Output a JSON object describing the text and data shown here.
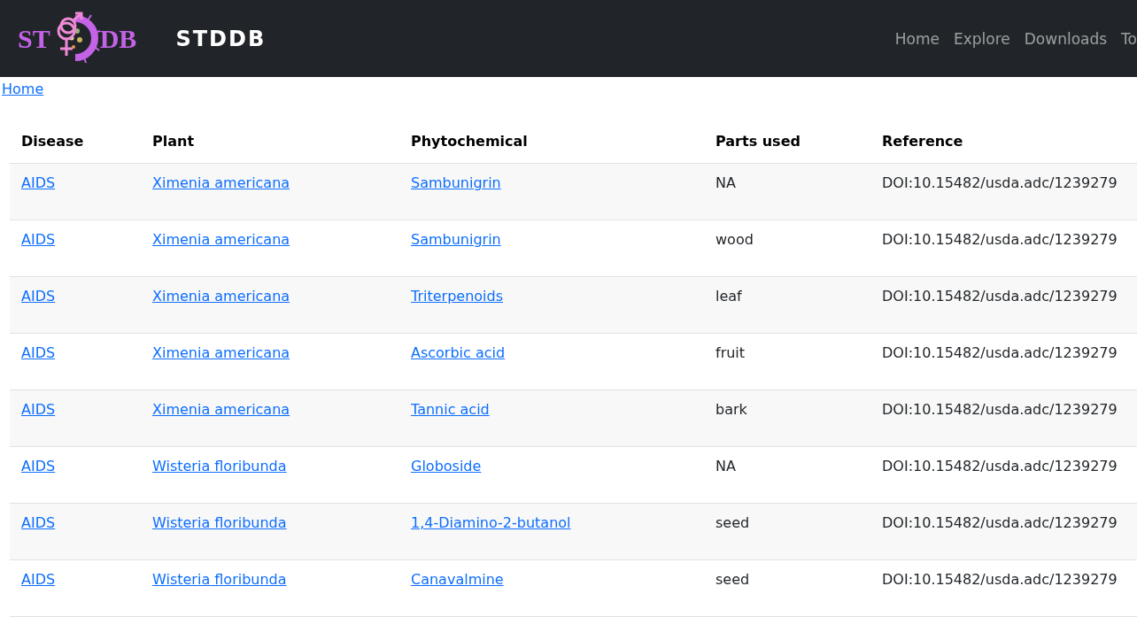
{
  "header": {
    "logo_text": [
      "ST",
      "DB"
    ],
    "brand": "STDDB",
    "nav": [
      "Home",
      "Explore",
      "Downloads",
      "To"
    ]
  },
  "breadcrumb": [
    "Home"
  ],
  "table": {
    "columns": [
      "Disease",
      "Plant",
      "Phytochemical",
      "Parts used",
      "Reference"
    ],
    "rows": [
      [
        "AIDS",
        "Ximenia americana",
        "Sambunigrin",
        "NA",
        "DOI:10.15482/usda.adc/1239279"
      ],
      [
        "AIDS",
        "Ximenia americana",
        "Sambunigrin",
        "wood",
        "DOI:10.15482/usda.adc/1239279"
      ],
      [
        "AIDS",
        "Ximenia americana",
        "Triterpenoids",
        "leaf",
        "DOI:10.15482/usda.adc/1239279"
      ],
      [
        "AIDS",
        "Ximenia americana",
        "Ascorbic acid",
        "fruit",
        "DOI:10.15482/usda.adc/1239279"
      ],
      [
        "AIDS",
        "Ximenia americana",
        "Tannic acid",
        "bark",
        "DOI:10.15482/usda.adc/1239279"
      ],
      [
        "AIDS",
        "Wisteria floribunda",
        "Globoside",
        "NA",
        "DOI:10.15482/usda.adc/1239279"
      ],
      [
        "AIDS",
        "Wisteria floribunda",
        "1,4-Diamino-2-butanol",
        "seed",
        "DOI:10.15482/usda.adc/1239279"
      ],
      [
        "AIDS",
        "Wisteria floribunda",
        "Canavalmine",
        "seed",
        "DOI:10.15482/usda.adc/1239279"
      ]
    ]
  }
}
